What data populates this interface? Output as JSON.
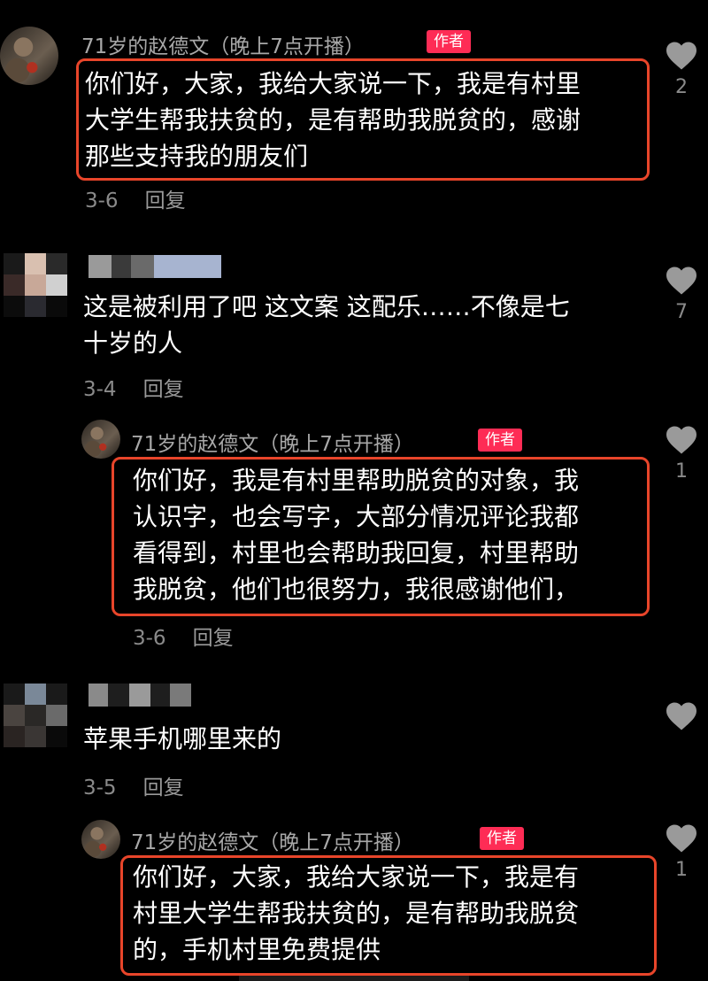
{
  "colors": {
    "background": "#000000",
    "author_badge": "#fe2c55",
    "highlight_border": "#e8452a",
    "meta_text": "#8a8a8a"
  },
  "comments": [
    {
      "username": "71岁的赵德文（晚上7点开播）",
      "badge": "作者",
      "lines": [
        "你们好，大家，我给大家说一下，我是有村里",
        "大学生帮我扶贫的，是有帮助我脱贫的，感谢",
        "那些支持我的朋友们"
      ],
      "date": "3-6",
      "reply_label": "回复",
      "likes": "2",
      "icon": "heart-icon"
    },
    {
      "username": "",
      "lines": [
        "这是被利用了吧 这文案 这配乐……不像是七",
        "十岁的人"
      ],
      "date": "3-4",
      "reply_label": "回复",
      "likes": "7",
      "icon": "heart-icon"
    },
    {
      "username": "71岁的赵德文（晚上7点开播）",
      "badge": "作者",
      "lines": [
        "你们好，我是有村里帮助脱贫的对象，我",
        "认识字，也会写字，大部分情况评论我都",
        "看得到，村里也会帮助我回复，村里帮助",
        "我脱贫，他们也很努力，我很感谢他们，"
      ],
      "date": "3-6",
      "reply_label": "回复",
      "likes": "1",
      "icon": "heart-icon"
    },
    {
      "username": "",
      "lines": [
        "苹果手机哪里来的"
      ],
      "date": "3-5",
      "reply_label": "回复",
      "likes": "",
      "icon": "heart-icon"
    },
    {
      "username": "71岁的赵德文（晚上7点开播）",
      "badge": "作者",
      "lines": [
        "你们好，大家，我给大家说一下，我是有",
        "村里大学生帮我扶贫的，是有帮助我脱贫",
        "的，手机村里免费提供"
      ],
      "date": "",
      "reply_label": "",
      "likes": "1",
      "icon": "heart-icon"
    }
  ]
}
